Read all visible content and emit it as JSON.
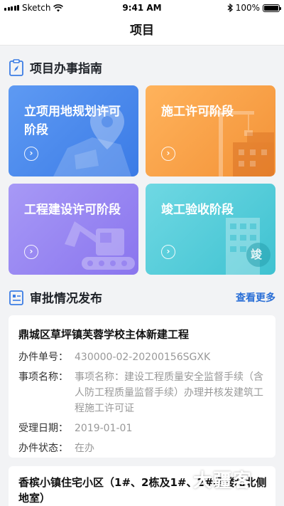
{
  "status_bar": {
    "carrier": "Sketch",
    "time": "9:41 AM",
    "battery": "100%",
    "battery_level": 1.0
  },
  "nav": {
    "title": "项目"
  },
  "guide": {
    "title": "项目办事指南",
    "tiles": [
      {
        "label": "立项用地规划许可阶段",
        "color": "#4a89ec"
      },
      {
        "label": "施工许可阶段",
        "color": "#f7a346"
      },
      {
        "label": "工程建设许可阶段",
        "color": "#9786f1"
      },
      {
        "label": "竣工验收阶段",
        "color": "#52ccd9",
        "badge": "竣"
      }
    ]
  },
  "approval": {
    "title": "审批情况发布",
    "more": "查看更多",
    "cards": [
      {
        "title": "鼎城区草坪镇芙蓉学校主体新建工程",
        "rows": [
          {
            "key": "办件单号：",
            "value": "430000-02-20200156SGXK"
          },
          {
            "key": "事项名称：",
            "value": "事项名称：建设工程质量安全监督手续（含人防工程质量监督手续）办理并核发建筑工程施工许可证"
          },
          {
            "key": "受理日期：",
            "value": "2019-01-01"
          },
          {
            "key": "办件状态：",
            "value": "在办"
          }
        ]
      },
      {
        "title": "香槟小镇住宅小区（1#、2栋及1#、2#裙楼和北侧地室）"
      }
    ]
  },
  "watermark": "大疆客"
}
